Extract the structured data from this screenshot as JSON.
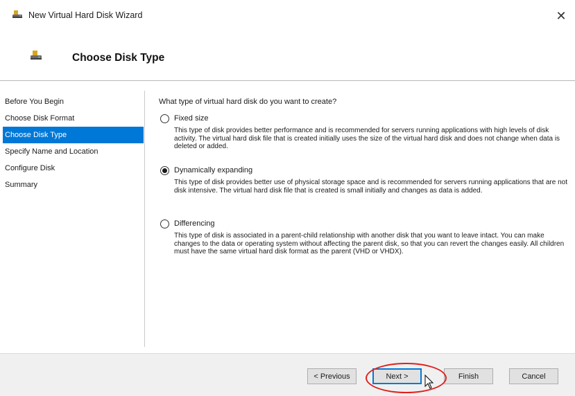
{
  "window": {
    "title": "New Virtual Hard Disk Wizard",
    "close_label": "✕"
  },
  "header": {
    "title": "Choose Disk Type"
  },
  "sidebar": {
    "steps": [
      {
        "label": "Before You Begin",
        "active": false
      },
      {
        "label": "Choose Disk Format",
        "active": false
      },
      {
        "label": "Choose Disk Type",
        "active": true
      },
      {
        "label": "Specify Name and Location",
        "active": false
      },
      {
        "label": "Configure Disk",
        "active": false
      },
      {
        "label": "Summary",
        "active": false
      }
    ]
  },
  "main": {
    "question": "What type of virtual hard disk do you want to create?",
    "options": [
      {
        "label": "Fixed size",
        "selected": false,
        "description": "This type of disk provides better performance and is recommended for servers running applications with high levels of disk activity. The virtual hard disk file that is created initially uses the size of the virtual hard disk and does not change when data is deleted or added."
      },
      {
        "label": "Dynamically expanding",
        "selected": true,
        "description": "This type of disk provides better use of physical storage space and is recommended for servers running applications that are not disk intensive. The virtual hard disk file that is created is small initially and changes as data is added."
      },
      {
        "label": "Differencing",
        "selected": false,
        "description": "This type of disk is associated in a parent-child relationship with another disk that you want to leave intact. You can make changes to the data or operating system without affecting the parent disk, so that you can revert the changes easily. All children must have the same virtual hard disk format as the parent (VHD or VHDX)."
      }
    ]
  },
  "footer": {
    "previous_label": "< Previous",
    "next_label": "Next >",
    "finish_label": "Finish",
    "cancel_label": "Cancel"
  },
  "colors": {
    "selection": "#0078d7",
    "highlight_oval": "#e0201c",
    "footer_bg": "#f0f0f0"
  },
  "icons": {
    "title": "disk-icon",
    "header": "disk-icon",
    "close": "close-icon",
    "cursor": "mouse-pointer-icon"
  }
}
